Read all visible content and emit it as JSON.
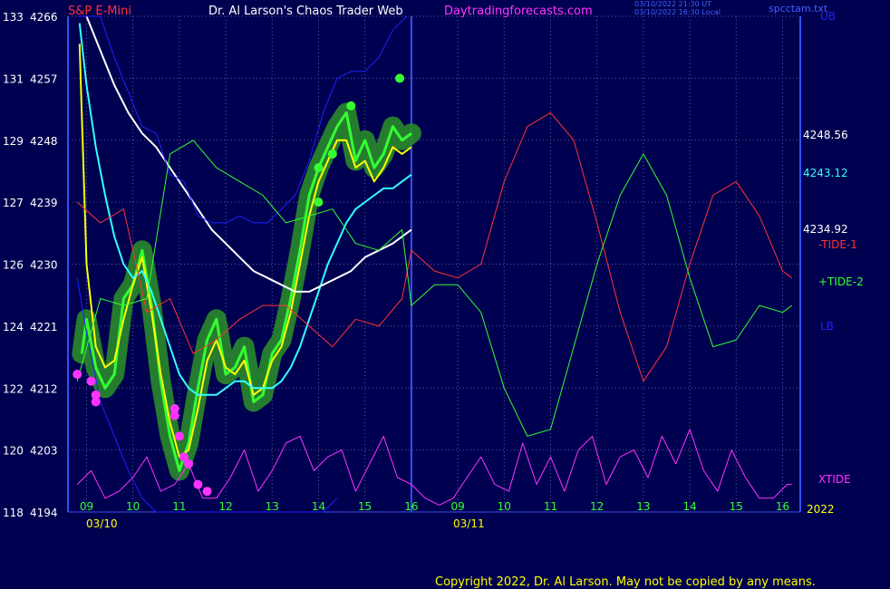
{
  "header": {
    "symbol": "S&P E-Mini",
    "title": "Dr. Al Larson's Chaos Trader Web",
    "site": "Daytradingforecasts.com",
    "timestamp1": "03/10/2022 21:30 UT",
    "timestamp2": "03/10/2022 16:30 Local",
    "file": "spcctam.txt"
  },
  "footer": {
    "copyright": "Copyright 2022, Dr. Al Larson. May not be copied by any means."
  },
  "colors": {
    "background": "#000050",
    "price": "#33ff33",
    "fast_avg": "#ffff00",
    "mid_avg": "#ff33ff",
    "slow_avg": "#33ffff",
    "slowest_avg": "#ffffff",
    "tide1": "#ff3333",
    "tide2": "#33ff33",
    "xtide": "#ff33ff",
    "bands": "#2020ff"
  },
  "chart_data": {
    "type": "line",
    "title": "",
    "y_left_ticks": [
      {
        "a": "133",
        "b": "4266",
        "v": 4266
      },
      {
        "a": "131",
        "b": "4257",
        "v": 4257
      },
      {
        "a": "129",
        "b": "4248",
        "v": 4248
      },
      {
        "a": "127",
        "b": "4239",
        "v": 4239
      },
      {
        "a": "126",
        "b": "4230",
        "v": 4230
      },
      {
        "a": "124",
        "b": "4221",
        "v": 4221
      },
      {
        "a": "122",
        "b": "4212",
        "v": 4212
      },
      {
        "a": "120",
        "b": "4203",
        "v": 4203
      },
      {
        "a": "118",
        "b": "4194",
        "v": 4194
      }
    ],
    "ylim": [
      4194,
      4266
    ],
    "x_hour_labels_day1": [
      "09",
      "10",
      "11",
      "12",
      "13",
      "14",
      "15",
      "16"
    ],
    "x_hour_labels_day2": [
      "09",
      "10",
      "11",
      "12",
      "13",
      "14",
      "15",
      "16"
    ],
    "dates": [
      "03/10",
      "03/11"
    ],
    "year_label": "2022",
    "right_labels": {
      "ub": "UB",
      "lb": "LB",
      "price1": "4248.56",
      "price2": "4243.12",
      "price3": "4234.92",
      "tide1": "-TIDE-1",
      "tide2": "+TIDE-2",
      "xtide": "XTIDE"
    },
    "series": [
      {
        "name": "price",
        "x": [
          8.9,
          9.0,
          9.2,
          9.4,
          9.6,
          9.8,
          10.0,
          10.2,
          10.4,
          10.6,
          10.8,
          11.0,
          11.2,
          11.4,
          11.6,
          11.8,
          12.0,
          12.2,
          12.4,
          12.6,
          12.8,
          13.0,
          13.2,
          13.4,
          13.6,
          13.8,
          14.0,
          14.2,
          14.4,
          14.6,
          14.8,
          15.0,
          15.2,
          15.4,
          15.6,
          15.8,
          16.0
        ],
        "y": [
          4217,
          4222,
          4215,
          4212,
          4214,
          4225,
          4227,
          4232,
          4224,
          4213,
          4205,
          4200,
          4204,
          4212,
          4219,
          4222,
          4214,
          4215,
          4218,
          4210,
          4211,
          4217,
          4219,
          4225,
          4232,
          4240,
          4244,
          4247,
          4250,
          4252,
          4245,
          4248,
          4244,
          4246,
          4250,
          4248,
          4249
        ]
      },
      {
        "name": "fast",
        "x": [
          8.85,
          9.0,
          9.2,
          9.4,
          9.6,
          9.8,
          10.0,
          10.2,
          10.4,
          10.6,
          10.8,
          11.0,
          11.2,
          11.4,
          11.6,
          11.8,
          12.0,
          12.2,
          12.4,
          12.6,
          12.8,
          13.0,
          13.2,
          13.4,
          13.6,
          13.8,
          14.0,
          14.2,
          14.4,
          14.6,
          14.8,
          15.0,
          15.2,
          15.4,
          15.6,
          15.8,
          16.0
        ],
        "y": [
          4262,
          4230,
          4218,
          4215,
          4216,
          4222,
          4227,
          4231,
          4223,
          4214,
          4207,
          4202,
          4203,
          4209,
          4216,
          4219,
          4215,
          4214,
          4216,
          4211,
          4212,
          4216,
          4218,
          4223,
          4230,
          4237,
          4242,
          4245,
          4248,
          4248,
          4244,
          4245,
          4242,
          4244,
          4247,
          4246,
          4247
        ]
      },
      {
        "name": "slow",
        "x": [
          8.85,
          9.0,
          9.2,
          9.4,
          9.6,
          9.8,
          10.0,
          10.2,
          10.4,
          10.6,
          10.8,
          11.0,
          11.2,
          11.4,
          11.6,
          11.8,
          12.0,
          12.2,
          12.4,
          12.6,
          12.8,
          13.0,
          13.2,
          13.4,
          13.6,
          13.8,
          14.0,
          14.2,
          14.4,
          14.6,
          14.8,
          15.0,
          15.2,
          15.4,
          15.6,
          15.8,
          16.0
        ],
        "y": [
          4265,
          4256,
          4247,
          4240,
          4234,
          4230,
          4228,
          4229,
          4226,
          4222,
          4218,
          4214,
          4212,
          4211,
          4211,
          4211,
          4212,
          4213,
          4213,
          4212,
          4212,
          4212,
          4213,
          4215,
          4218,
          4222,
          4226,
          4230,
          4233,
          4236,
          4238,
          4239,
          4240,
          4241,
          4241,
          4242,
          4243
        ]
      },
      {
        "name": "slowest",
        "x": [
          9.0,
          9.3,
          9.6,
          9.9,
          10.2,
          10.5,
          10.8,
          11.1,
          11.4,
          11.7,
          12.0,
          12.3,
          12.6,
          12.9,
          13.2,
          13.5,
          13.8,
          14.1,
          14.4,
          14.7,
          15.0,
          15.3,
          15.6,
          16.0
        ],
        "y": [
          4266,
          4261,
          4256,
          4252,
          4249,
          4247,
          4244,
          4241,
          4238,
          4235,
          4233,
          4231,
          4229,
          4228,
          4227,
          4226,
          4226,
          4227,
          4228,
          4229,
          4231,
          4232,
          4233,
          4235
        ]
      },
      {
        "name": "ub",
        "x": [
          8.8,
          9.0,
          9.3,
          9.6,
          9.9,
          10.2,
          10.5,
          10.8,
          11.1,
          11.4,
          11.7,
          12.0,
          12.3,
          12.6,
          12.9,
          13.2,
          13.5,
          13.8,
          14.1,
          14.4,
          14.7,
          15.0,
          15.3,
          15.6,
          15.9
        ],
        "y": [
          4266,
          4266,
          4266,
          4260,
          4255,
          4250,
          4249,
          4243,
          4242,
          4237,
          4236,
          4236,
          4237,
          4236,
          4236,
          4238,
          4240,
          4245,
          4252,
          4257,
          4258,
          4258,
          4260,
          4264,
          4266
        ]
      },
      {
        "name": "lb",
        "x": [
          8.8,
          9.0,
          9.3,
          9.6,
          9.9,
          10.2,
          10.5,
          10.8,
          11.1,
          11.4,
          11.7,
          12.0,
          12.3,
          12.6,
          12.9,
          13.2,
          13.5,
          13.8,
          14.1,
          14.4
        ],
        "y": [
          4228,
          4220,
          4210,
          4205,
          4200,
          4196,
          4194,
          4194,
          4194,
          4194,
          4194,
          4194,
          4194,
          4194,
          4194,
          4194,
          4194,
          4194,
          4194,
          4196
        ]
      },
      {
        "name": "tide1",
        "x": [
          8.8,
          9.3,
          9.8,
          10.3,
          10.8,
          11.3,
          11.8,
          12.3,
          12.8,
          13.3,
          13.8,
          14.3,
          14.8,
          15.3,
          15.8,
          16.0,
          16.5,
          17.0,
          17.5,
          18.0,
          18.5,
          19.0,
          19.5,
          20.0,
          20.5,
          21.0,
          21.5,
          22.0,
          22.5,
          23.0,
          23.5,
          24.0,
          24.2
        ],
        "y": [
          4239,
          4236,
          4238,
          4223,
          4225,
          4217,
          4219,
          4222,
          4224,
          4224,
          4221,
          4218,
          4222,
          4221,
          4225,
          4232,
          4229,
          4228,
          4230,
          4242,
          4250,
          4252,
          4248,
          4236,
          4223,
          4213,
          4218,
          4230,
          4240,
          4242,
          4237,
          4229,
          4228
        ]
      },
      {
        "name": "tide2",
        "x": [
          8.8,
          9.3,
          9.8,
          10.3,
          10.8,
          11.3,
          11.8,
          12.3,
          12.8,
          13.3,
          13.8,
          14.3,
          14.8,
          15.3,
          15.8,
          16.0,
          16.5,
          17.0,
          17.5,
          18.0,
          18.5,
          19.0,
          19.5,
          20.0,
          20.5,
          21.0,
          21.5,
          22.0,
          22.5,
          23.0,
          23.5,
          24.0,
          24.2
        ],
        "y": [
          4213,
          4225,
          4224,
          4225,
          4246,
          4248,
          4244,
          4242,
          4240,
          4236,
          4237,
          4238,
          4233,
          4232,
          4235,
          4224,
          4227,
          4227,
          4223,
          4212,
          4205,
          4206,
          4218,
          4230,
          4240,
          4246,
          4240,
          4228,
          4218,
          4219,
          4224,
          4223,
          4224
        ]
      },
      {
        "name": "xtide",
        "x": [
          8.8,
          9.1,
          9.4,
          9.7,
          10.0,
          10.3,
          10.6,
          10.9,
          11.2,
          11.5,
          11.8,
          12.1,
          12.4,
          12.7,
          13.0,
          13.3,
          13.6,
          13.9,
          14.2,
          14.5,
          14.8,
          15.1,
          15.4,
          15.7,
          16.0,
          16.3,
          16.6,
          16.9,
          17.2,
          17.5,
          17.8,
          18.1,
          18.4,
          18.7,
          19.0,
          19.3,
          19.6,
          19.9,
          20.2,
          20.5,
          20.8,
          21.1,
          21.4,
          21.7,
          22.0,
          22.3,
          22.6,
          22.9,
          23.2,
          23.5,
          23.8,
          24.1,
          24.2
        ],
        "y": [
          4198,
          4200,
          4196,
          4197,
          4199,
          4202,
          4197,
          4198,
          4201,
          4196,
          4196,
          4199,
          4203,
          4197,
          4200,
          4204,
          4205,
          4200,
          4202,
          4203,
          4197,
          4201,
          4205,
          4199,
          4198,
          4196,
          4195,
          4196,
          4199,
          4202,
          4198,
          4197,
          4204,
          4198,
          4202,
          4197,
          4203,
          4205,
          4198,
          4202,
          4203,
          4199,
          4205,
          4201,
          4206,
          4200,
          4197,
          4203,
          4199,
          4196,
          4196,
          4198,
          4198
        ]
      }
    ],
    "peaks": [
      {
        "x": 14.0,
        "y": 4244
      },
      {
        "x": 14.3,
        "y": 4246
      },
      {
        "x": 14.7,
        "y": 4253
      },
      {
        "x": 15.75,
        "y": 4257
      },
      {
        "x": 14.0,
        "y": 4239
      }
    ],
    "troughs": [
      {
        "x": 8.8,
        "y": 4214
      },
      {
        "x": 9.1,
        "y": 4213
      },
      {
        "x": 9.2,
        "y": 4211
      },
      {
        "x": 9.2,
        "y": 4210
      },
      {
        "x": 10.9,
        "y": 4209
      },
      {
        "x": 10.9,
        "y": 4208
      },
      {
        "x": 11.0,
        "y": 4205
      },
      {
        "x": 11.1,
        "y": 4202
      },
      {
        "x": 11.2,
        "y": 4201
      },
      {
        "x": 11.4,
        "y": 4198
      },
      {
        "x": 11.6,
        "y": 4197
      }
    ]
  }
}
